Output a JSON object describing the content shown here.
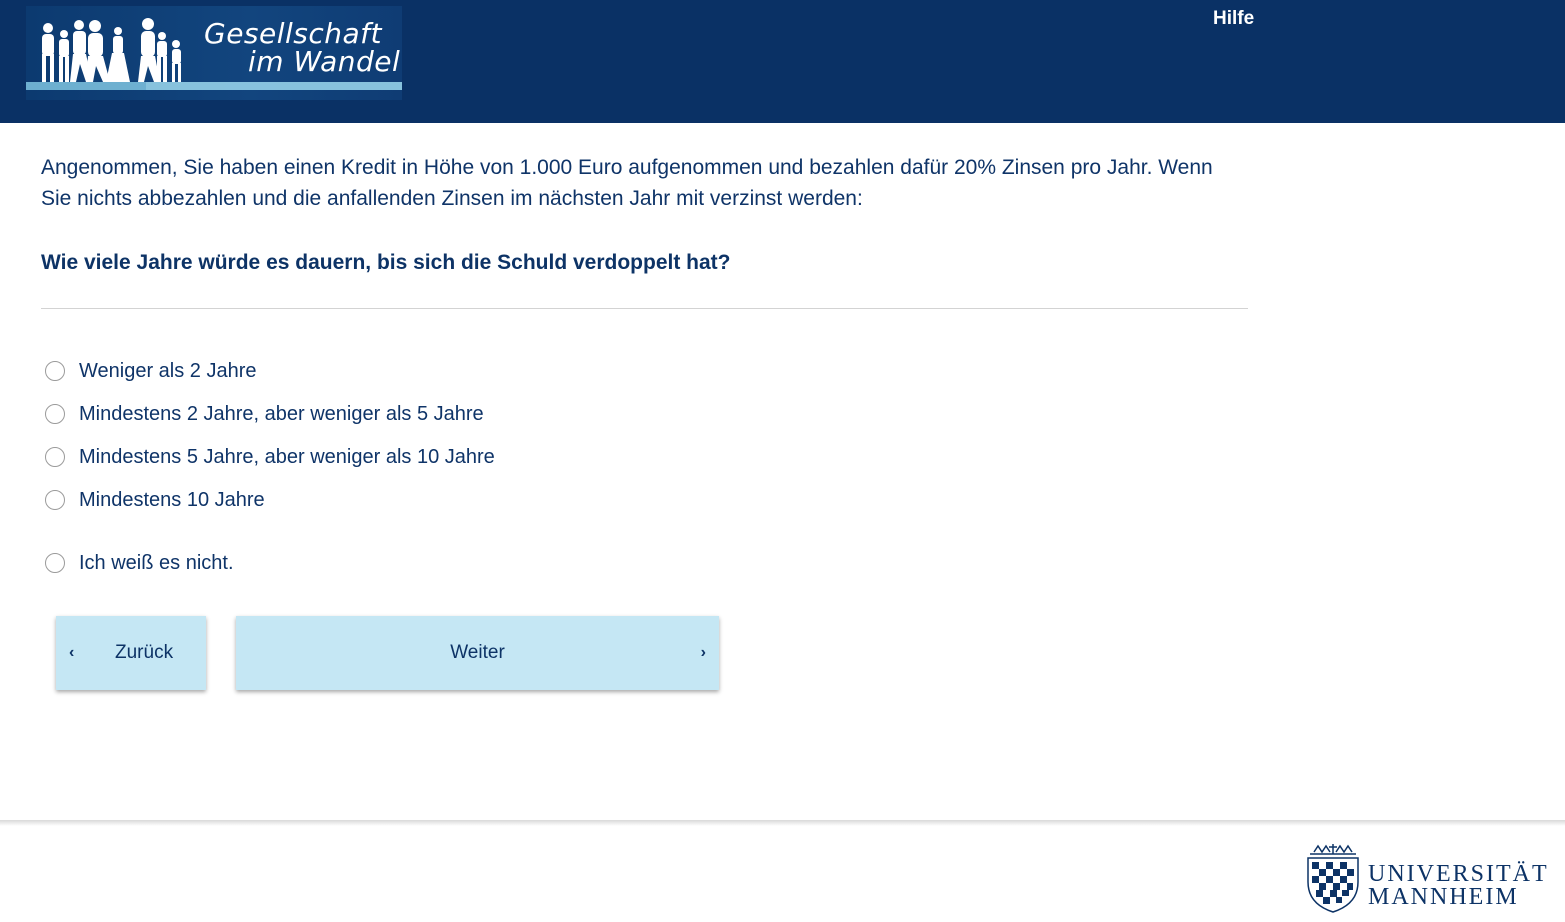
{
  "header": {
    "logo": {
      "line1": "Gesellschaft",
      "line2": "im Wandel"
    },
    "help_label": "Hilfe"
  },
  "question": {
    "intro": "Angenommen, Sie haben einen Kredit in Höhe von 1.000 Euro aufgenommen und bezahlen dafür 20% Zinsen pro Jahr. Wenn Sie nichts abbezahlen und die anfallenden Zinsen im nächsten Jahr mit verzinst werden:",
    "text": "Wie viele Jahre würde es dauern, bis sich die Schuld verdoppelt hat?"
  },
  "options": [
    {
      "label": "Weniger als 2 Jahre",
      "selected": false
    },
    {
      "label": "Mindestens 2 Jahre, aber weniger als 5 Jahre",
      "selected": false
    },
    {
      "label": "Mindestens 5 Jahre, aber weniger als 10 Jahre",
      "selected": false
    },
    {
      "label": "Mindestens 10 Jahre",
      "selected": false
    },
    {
      "label": "Ich weiß es nicht.",
      "selected": false
    }
  ],
  "nav": {
    "back_label": "Zurück",
    "next_label": "Weiter",
    "back_icon": "chevron-left-icon",
    "next_icon": "chevron-right-icon"
  },
  "footer": {
    "university_line1": "UNIVERSITÄT",
    "university_line2": "MANNHEIM"
  },
  "colors": {
    "header_bg": "#0a3165",
    "text": "#0d3366",
    "button_bg": "#c5e7f4"
  }
}
